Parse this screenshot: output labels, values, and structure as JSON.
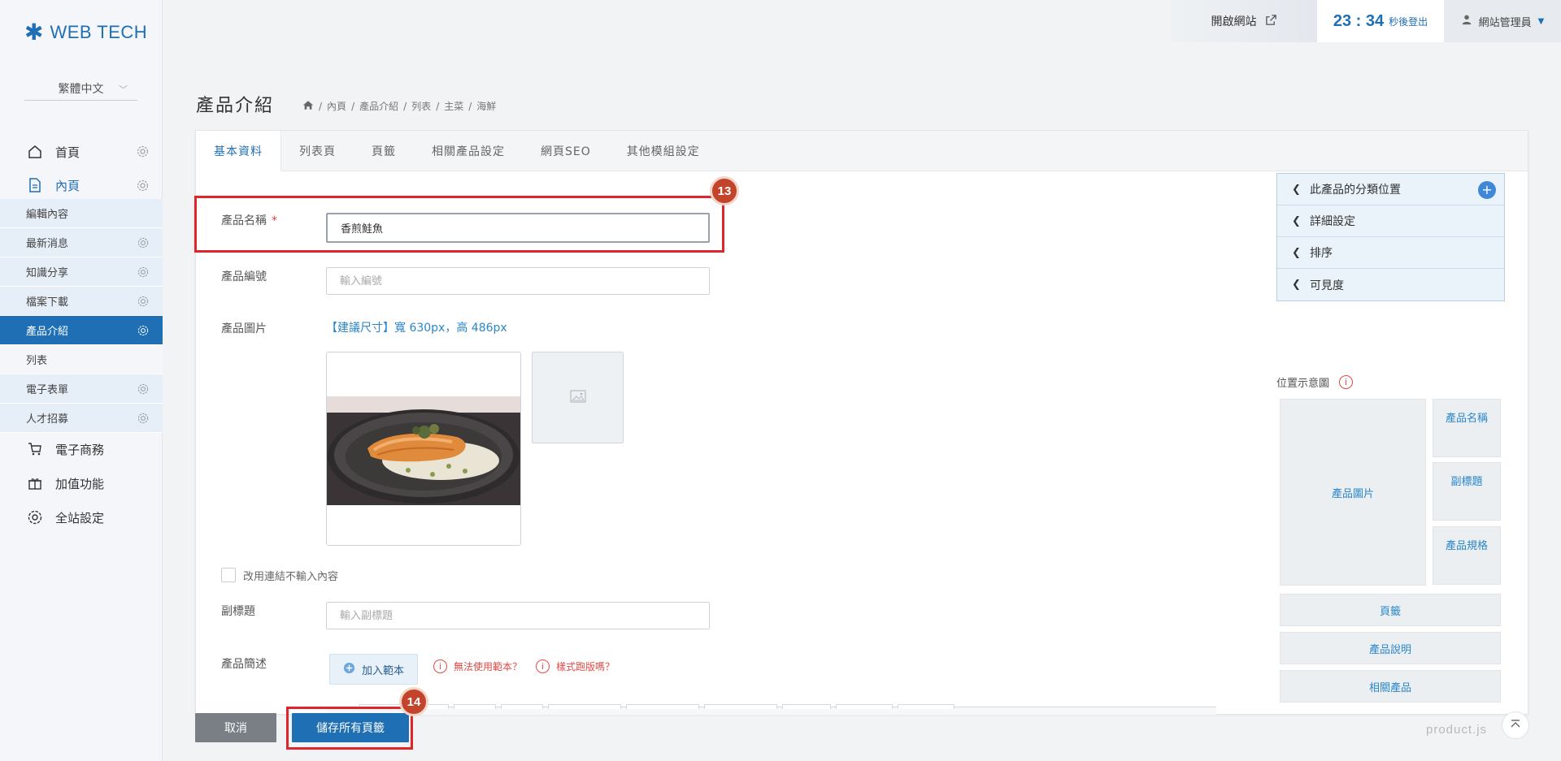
{
  "brand": {
    "name": "WEB TECH"
  },
  "language": {
    "selected": "繁體中文"
  },
  "nav": {
    "home": "首頁",
    "inner": "內頁",
    "sub": [
      {
        "label": "編輯內容"
      },
      {
        "label": "最新消息"
      },
      {
        "label": "知識分享"
      },
      {
        "label": "檔案下載"
      },
      {
        "label": "產品介紹"
      },
      {
        "label": "列表"
      },
      {
        "label": "電子表單"
      },
      {
        "label": "人才招募"
      }
    ],
    "ecommerce": "電子商務",
    "addons": "加值功能",
    "site_settings": "全站設定"
  },
  "topbar": {
    "open_site": "開啟網站",
    "timer": "23 : 34",
    "timer_suffix": "秒後登出",
    "user": "網站管理員"
  },
  "page": {
    "title": "產品介紹",
    "breadcrumb": [
      "內頁",
      "產品介紹",
      "列表",
      "主菜",
      "海鮮"
    ]
  },
  "tabs": [
    "基本資料",
    "列表頁",
    "頁籤",
    "相關產品設定",
    "網頁SEO",
    "其他模組設定"
  ],
  "form": {
    "name_label": "產品名稱",
    "name_required": "*",
    "name_value": "香煎鮭魚",
    "code_label": "產品編號",
    "code_placeholder": "輸入編號",
    "image_label": "產品圖片",
    "image_hint": "【建議尺寸】寬 630px，高 486px",
    "link_checkbox": "改用連結不輸入內容",
    "subtitle_label": "副標題",
    "subtitle_placeholder": "輸入副標題",
    "desc_label": "產品簡述",
    "add_template": "加入範本",
    "warn1": "無法使用範本？",
    "warn2": "樣式跑版嗎？"
  },
  "annotations": {
    "badge1": "13",
    "badge2": "14"
  },
  "side": {
    "accordion": [
      "此產品的分類位置",
      "詳細設定",
      "排序",
      "可見度"
    ],
    "position_label": "位置示意圖",
    "blocks": {
      "image": "產品圖片",
      "name": "產品名稱",
      "subtitle": "副標題",
      "spec": "產品規格",
      "tabs": "頁籤",
      "desc": "產品說明",
      "related": "相關產品"
    }
  },
  "footer": {
    "cancel": "取消",
    "save_all": "儲存所有頁籤",
    "filename": "product.js"
  },
  "colors": {
    "accent": "#1f6fb5",
    "highlight": "#e0262a",
    "badge": "#c2442a"
  }
}
